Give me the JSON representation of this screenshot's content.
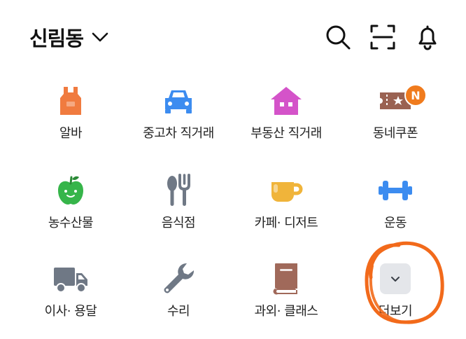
{
  "header": {
    "location": "신림동",
    "icons": [
      "search-icon",
      "scan-icon",
      "bell-icon"
    ]
  },
  "categories": [
    {
      "label": "알바",
      "icon": "apron-icon",
      "color": "#F07B3F"
    },
    {
      "label": "중고차 직거래",
      "icon": "car-icon",
      "color": "#3C8CF0"
    },
    {
      "label": "부동산 직거래",
      "icon": "house-icon",
      "color": "#D453C9"
    },
    {
      "label": "동네쿠폰",
      "icon": "ticket-icon",
      "color": "#9A6252",
      "badge": "N",
      "badge_color": "#F07B1D"
    },
    {
      "label": "농수산물",
      "icon": "apple-icon",
      "color": "#36B54A"
    },
    {
      "label": "음식점",
      "icon": "utensils-icon",
      "color": "#6F7885"
    },
    {
      "label": "카페· 디저트",
      "icon": "cup-icon",
      "color": "#F0B43A"
    },
    {
      "label": "운동",
      "icon": "dumbbell-icon",
      "color": "#3C8CF0"
    },
    {
      "label": "이사· 용달",
      "icon": "truck-icon",
      "color": "#6F7885"
    },
    {
      "label": "수리",
      "icon": "wrench-icon",
      "color": "#6F7885"
    },
    {
      "label": "과외· 클래스",
      "icon": "book-icon",
      "color": "#A0695A"
    },
    {
      "label": "더보기",
      "icon": "chevron-down-icon",
      "color": "#E4E6EA"
    }
  ],
  "annotation_color": "#F26A1B"
}
